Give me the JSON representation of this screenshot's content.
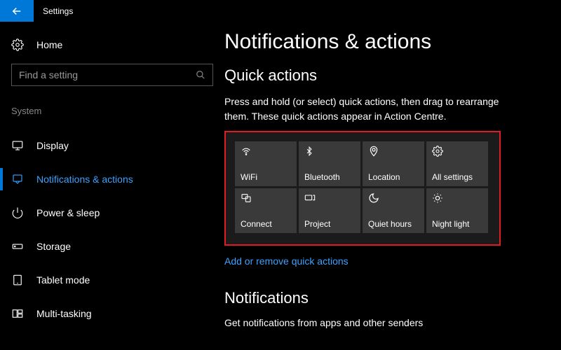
{
  "title": "Settings",
  "home_label": "Home",
  "search_placeholder": "Find a setting",
  "group_label": "System",
  "nav": [
    {
      "label": "Display"
    },
    {
      "label": "Notifications & actions"
    },
    {
      "label": "Power & sleep"
    },
    {
      "label": "Storage"
    },
    {
      "label": "Tablet mode"
    },
    {
      "label": "Multi-tasking"
    }
  ],
  "page_title": "Notifications & actions",
  "quick_actions_title": "Quick actions",
  "quick_actions_desc": "Press and hold (or select) quick actions, then drag to rearrange them. These quick actions appear in Action Centre.",
  "tiles": [
    {
      "label": "WiFi"
    },
    {
      "label": "Bluetooth"
    },
    {
      "label": "Location"
    },
    {
      "label": "All settings"
    },
    {
      "label": "Connect"
    },
    {
      "label": "Project"
    },
    {
      "label": "Quiet hours"
    },
    {
      "label": "Night light"
    }
  ],
  "link_text": "Add or remove quick actions",
  "notifications_title": "Notifications",
  "notifications_desc": "Get notifications from apps and other senders"
}
